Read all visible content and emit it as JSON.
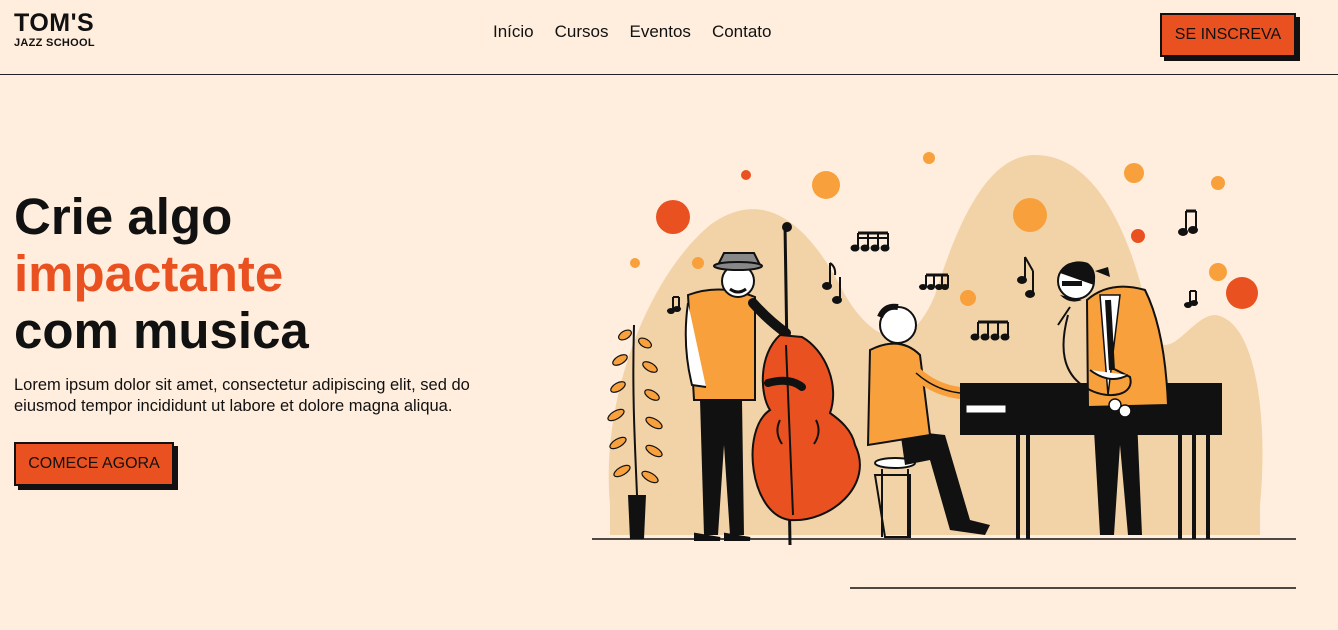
{
  "brand": {
    "name": "TOM'S",
    "subtitle": "JAZZ SCHOOL"
  },
  "nav": {
    "items": [
      {
        "label": "Início"
      },
      {
        "label": "Cursos"
      },
      {
        "label": "Eventos"
      },
      {
        "label": "Contato"
      }
    ]
  },
  "header": {
    "cta_label": "SE INSCREVA"
  },
  "hero": {
    "title_line1": "Crie algo",
    "title_line2": "impactante",
    "title_line3": "com musica",
    "description": "Lorem ipsum dolor sit amet, consectetur adipiscing elit, sed do eiusmod tempor incididunt ut labore et dolore magna aliqua.",
    "cta_label": "COMECE AGORA"
  },
  "colors": {
    "background": "#ffeedd",
    "accent": "#ea5120",
    "accent_light": "#f8a03c",
    "blob": "#f2d3a8",
    "ink": "#111111"
  },
  "illustration": {
    "icon": "jazz-band-illustration",
    "figures": [
      "bassist",
      "pianist",
      "saxophonist",
      "potted-plant"
    ]
  }
}
